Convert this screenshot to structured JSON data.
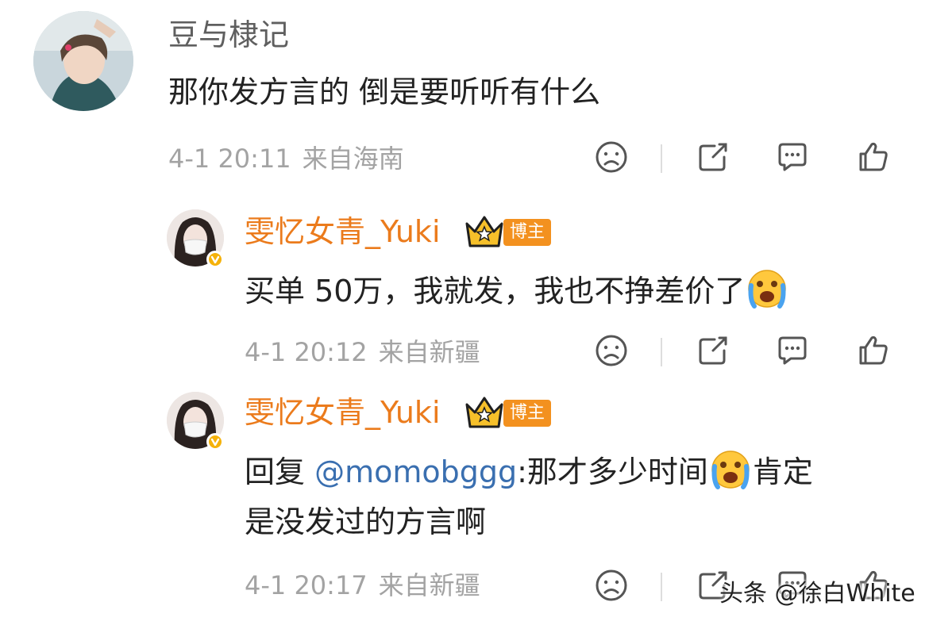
{
  "main_comment": {
    "username": "豆与棣记",
    "text": "那你发方言的 倒是要听听有什么",
    "time": "4-1 20:11",
    "location": "来自海南"
  },
  "replies": [
    {
      "username": "雯忆女青_Yuki",
      "badge": "博主",
      "text_before": "买单 50万，我就发，我也不挣差价了",
      "emoji_after": "crying-emoji",
      "time": "4-1 20:12",
      "location": "来自新疆"
    },
    {
      "username": "雯忆女青_Yuki",
      "badge": "博主",
      "reply_prefix": "回复 ",
      "mention": "@momobggg",
      "line1_after": ":那才多少时间",
      "line1_tail": "肯定",
      "line2": "是没发过的方言啊",
      "time": "4-1 20:17",
      "location": "来自新疆"
    }
  ],
  "watermark": "头条 @徐白White",
  "icons": {
    "dislike": "sad-face-icon",
    "share": "share-icon",
    "comment": "comment-icon",
    "like": "thumbs-up-icon"
  },
  "colors": {
    "username_accent": "#eb7b1c",
    "badge_bg": "#f3911f",
    "mention": "#3a6fb0",
    "meta_gray": "#a3a3a3"
  }
}
